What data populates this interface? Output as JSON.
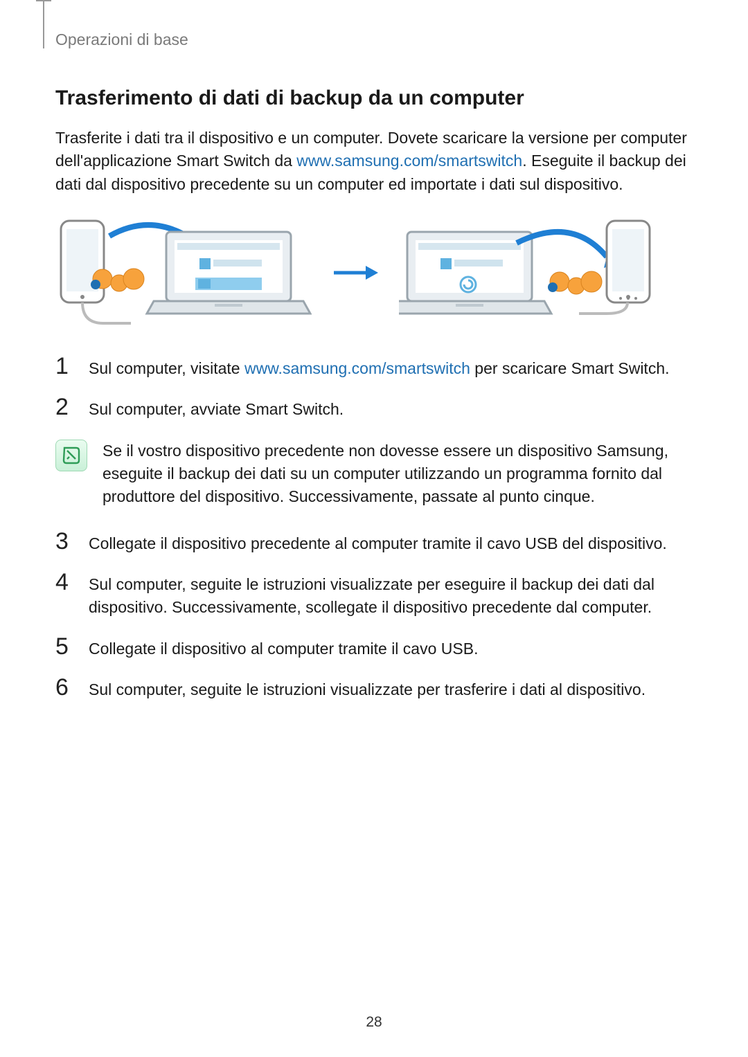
{
  "section_label": "Operazioni di base",
  "heading": "Trasferimento di dati di backup da un computer",
  "intro": {
    "part1": "Trasferite i dati tra il dispositivo e un computer. Dovete scaricare la versione per computer dell'applicazione Smart Switch da ",
    "link1": "www.samsung.com/smartswitch",
    "part2": ". Eseguite il backup dei dati dal dispositivo precedente su un computer ed importate i dati sul dispositivo."
  },
  "steps": {
    "s1": {
      "num": "1",
      "before": "Sul computer, visitate ",
      "link": "www.samsung.com/smartswitch",
      "after": " per scaricare Smart Switch."
    },
    "s2": {
      "num": "2",
      "text": "Sul computer, avviate Smart Switch."
    },
    "s3": {
      "num": "3",
      "text": "Collegate il dispositivo precedente al computer tramite il cavo USB del dispositivo."
    },
    "s4": {
      "num": "4",
      "text": "Sul computer, seguite le istruzioni visualizzate per eseguire il backup dei dati dal dispositivo. Successivamente, scollegate il dispositivo precedente dal computer."
    },
    "s5": {
      "num": "5",
      "text": "Collegate il dispositivo al computer tramite il cavo USB."
    },
    "s6": {
      "num": "6",
      "text": "Sul computer, seguite le istruzioni visualizzate per trasferire i dati al dispositivo."
    }
  },
  "note_text": "Se il vostro dispositivo precedente non dovesse essere un dispositivo Samsung, eseguite il backup dei dati su un computer utilizzando un programma fornito dal produttore del dispositivo. Successivamente, passate al punto cinque.",
  "page_number": "28",
  "colors": {
    "link": "#1f6fb2",
    "muted": "#7a7a7a"
  }
}
